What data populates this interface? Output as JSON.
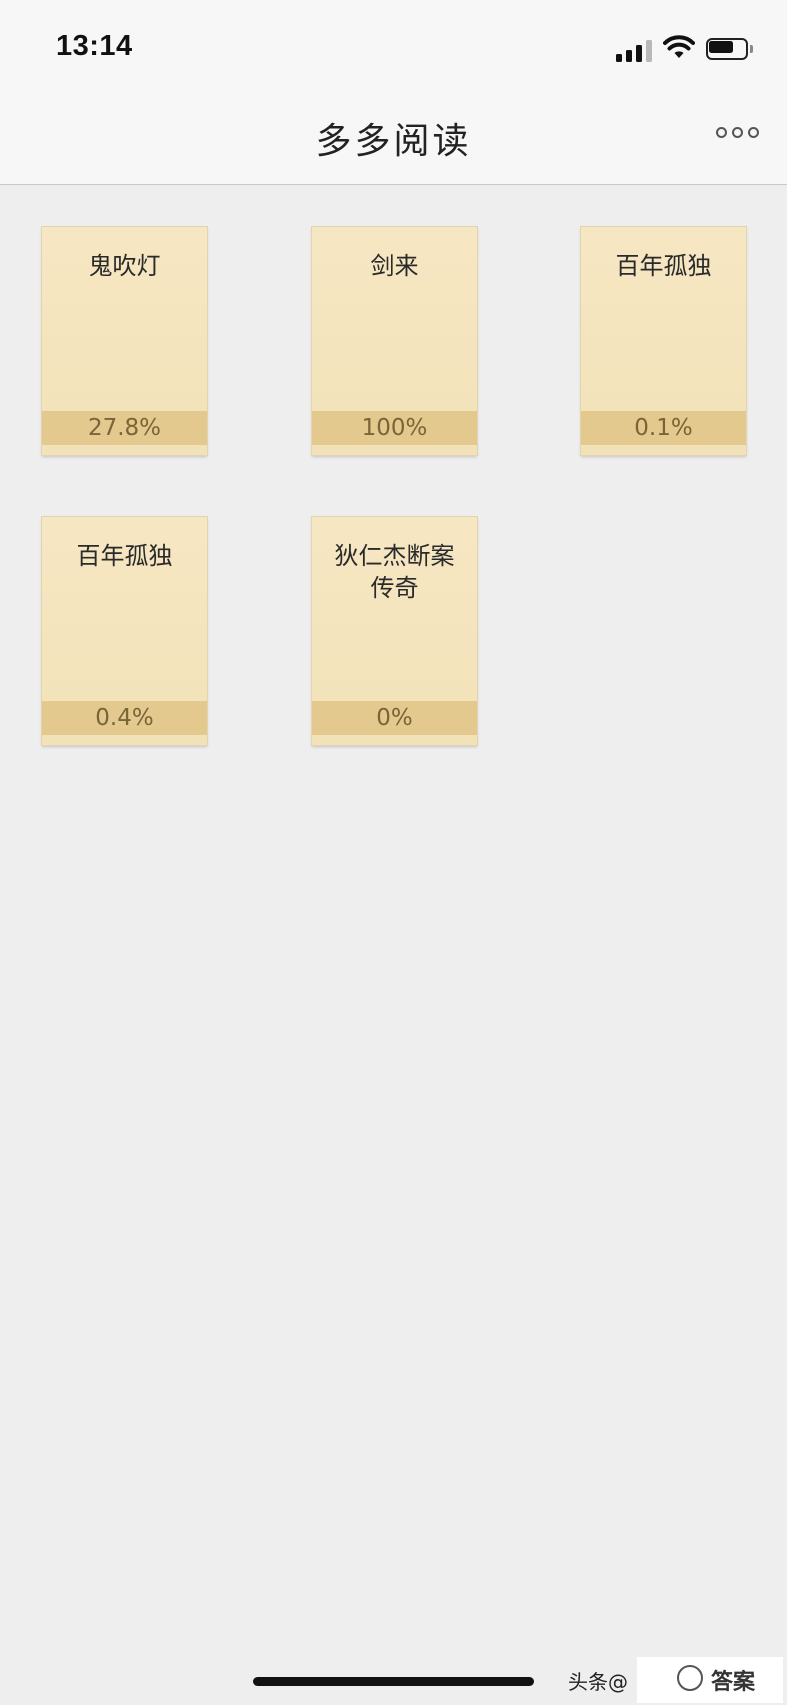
{
  "status_bar": {
    "time": "13:14",
    "signal_bars": 4,
    "signal_active_bars": 3,
    "battery_level": 0.7
  },
  "nav": {
    "title": "多多阅读",
    "more_icon": "more-dots-icon"
  },
  "books": [
    {
      "title": "鬼吹灯",
      "progress": "27.8%"
    },
    {
      "title": "剑来",
      "progress": "100%"
    },
    {
      "title": "百年孤独",
      "progress": "0.1%"
    },
    {
      "title": "百年孤独",
      "progress": "0.4%"
    },
    {
      "title": "狄仁杰断案传奇",
      "progress": "0%"
    }
  ],
  "watermark": {
    "text": "头条@",
    "logo_text": "答案"
  },
  "colors": {
    "background": "#efeeee",
    "card": "#f4e5bf",
    "progress_band": "#e3c98d",
    "progress_text": "#7a6438"
  }
}
